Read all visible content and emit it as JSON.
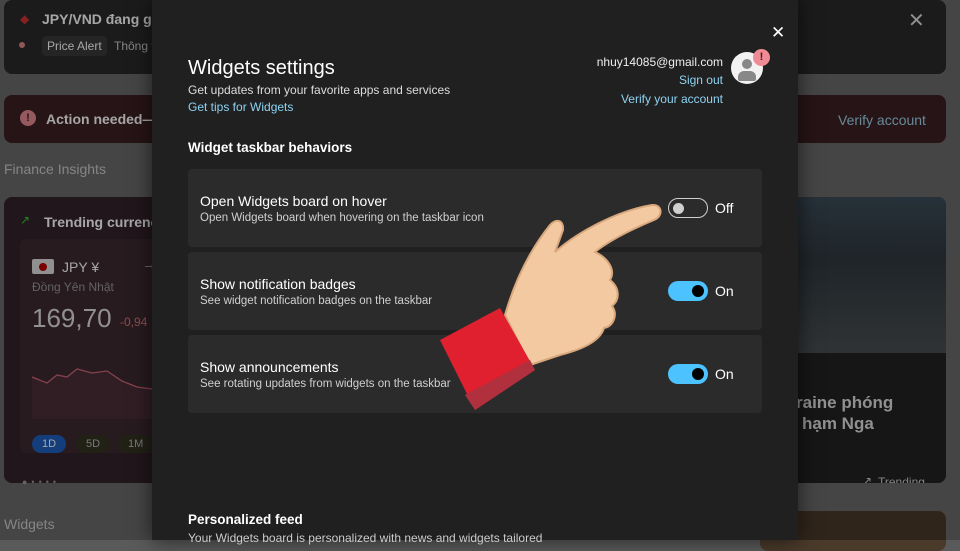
{
  "background": {
    "alert_title": "JPY/VND đang giả",
    "alert_tag": "Price Alert",
    "alert_tag2": "Thông t",
    "action_text": "Action needed—",
    "verify_account": "Verify account",
    "finance_section": "Finance Insights",
    "trending_title": "Trending currenci",
    "currency": "JPY ¥",
    "currency_name": "Đồng Yên Nhật",
    "price": "169,70",
    "change": "-0,94",
    "ranges": [
      "1D",
      "5D",
      "1M"
    ],
    "widgets_section": "Widgets",
    "news_headline_1": "raine phóng",
    "news_headline_2": "hạm Nga",
    "news_tag": "Trending"
  },
  "modal": {
    "title": "Widgets settings",
    "subtitle": "Get updates from your favorite apps and services",
    "tips_link": "Get tips for Widgets",
    "email": "nhuy14085@gmail.com",
    "sign_out": "Sign out",
    "verify": "Verify your account",
    "section_title": "Widget taskbar behaviors",
    "settings": [
      {
        "title": "Open Widgets board on hover",
        "desc": "Open Widgets board when hovering on the taskbar icon",
        "state": "Off"
      },
      {
        "title": "Show notification badges",
        "desc": "See widget notification badges on the taskbar",
        "state": "On"
      },
      {
        "title": "Show announcements",
        "desc": "See rotating updates from widgets on the taskbar",
        "state": "On"
      }
    ],
    "feed_title": "Personalized feed",
    "feed_desc": "Your Widgets board is personalized with news and widgets tailored"
  },
  "colors": {
    "accent": "#4cc2ff",
    "link": "#8ed3f3",
    "modal_bg": "#202020"
  }
}
